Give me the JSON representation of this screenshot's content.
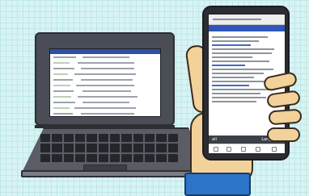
{
  "phone": {
    "bottom_left_label": "all",
    "bottom_right_label": "Language"
  }
}
